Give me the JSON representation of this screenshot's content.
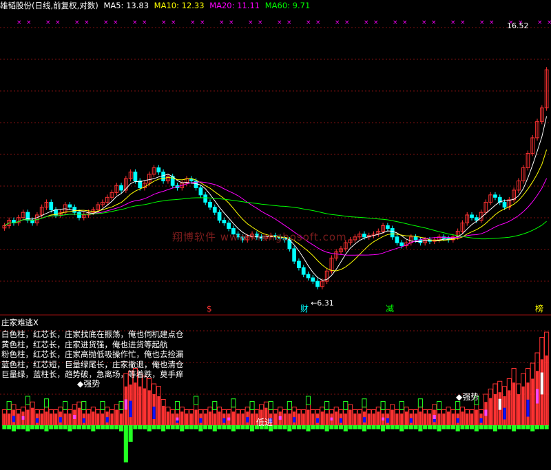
{
  "header": {
    "title": "雄韬股份(日线,前复权,对数)",
    "ma5_label": "MA5: 13.83",
    "ma10_label": "MA10: 12.33",
    "ma20_label": "MA20: 11.11",
    "ma60_label": "MA60: 9.71"
  },
  "colors": {
    "up": "#ff3232",
    "down": "#00ffff",
    "ma5": "#ffffff",
    "ma10": "#ffff00",
    "ma20": "#ff00ff",
    "ma60": "#00ff00",
    "grid": "#801010",
    "marker": "#ff00ff",
    "green_bar": "#22ff22",
    "blue_bar": "#1010ff",
    "pink_bar": "#ff44ff",
    "white_bar": "#ffffff"
  },
  "price_chart": {
    "high_label": "16.52",
    "low_label": "6.31",
    "signal_labels": [
      "$",
      "财",
      "减",
      "榜"
    ],
    "watermark": "翔博软件 www.xiangbosoft.com"
  },
  "indicator": {
    "title": "庄家难逃X",
    "legend_lines": [
      "白色柱，红芯长，庄家找底在振荡，俺也伺机建点仓",
      "黄色柱，红芯长，庄家进货强，俺也进货等起航",
      "粉色柱，红芯长，庄家高抛低吸操作忙，俺也去捡漏",
      "蓝色柱，红芯短，巨量绿尾长，庄家撤退，俺也清仓",
      "巨量绿，蓝柱长，趋势破，急离场，等着跌，莫手痒"
    ],
    "annotations": [
      "◆强势",
      "◆强势",
      "低进"
    ]
  },
  "chart_data": {
    "type": "candlestick",
    "title": "雄韬股份(日线,前复权,对数)",
    "yscale": "log",
    "ylim": [
      6.0,
      17.5
    ],
    "annotated_high": 16.52,
    "annotated_low": 6.31,
    "series_ma": [
      {
        "name": "MA5",
        "last": 13.83
      },
      {
        "name": "MA10",
        "last": 12.33
      },
      {
        "name": "MA20",
        "last": 11.11
      },
      {
        "name": "MA60",
        "last": 9.71
      }
    ],
    "closes": [
      8.4,
      8.6,
      8.5,
      8.7,
      8.9,
      8.6,
      8.5,
      8.8,
      9.1,
      9.3,
      9.0,
      8.8,
      8.9,
      9.2,
      9.1,
      8.9,
      8.7,
      8.8,
      8.9,
      9.0,
      9.2,
      9.3,
      9.5,
      9.7,
      10.0,
      9.8,
      10.3,
      10.6,
      10.2,
      9.9,
      10.1,
      10.5,
      10.8,
      10.6,
      10.2,
      10.4,
      10.0,
      9.9,
      10.1,
      10.3,
      10.2,
      9.9,
      9.6,
      9.3,
      9.1,
      8.9,
      8.6,
      8.5,
      8.3,
      8.1,
      8.0,
      7.9,
      8.0,
      8.1,
      8.0,
      7.95,
      8.0,
      8.05,
      8.0,
      7.95,
      7.9,
      7.6,
      7.2,
      7.0,
      6.8,
      6.7,
      6.6,
      6.45,
      6.6,
      6.9,
      7.3,
      7.5,
      7.6,
      7.8,
      7.9,
      8.0,
      8.1,
      8.0,
      8.05,
      8.1,
      8.2,
      8.4,
      8.3,
      8.0,
      7.8,
      7.7,
      7.8,
      8.0,
      7.9,
      7.8,
      7.9,
      7.85,
      7.9,
      8.0,
      7.95,
      7.9,
      8.0,
      8.2,
      8.5,
      8.8,
      8.7,
      8.6,
      8.9,
      9.3,
      9.6,
      9.5,
      9.3,
      9.1,
      9.4,
      9.8,
      10.2,
      10.8,
      11.5,
      12.3,
      13.2,
      14.0,
      16.52
    ],
    "indicator_bars": [
      0.3,
      0.3,
      0.4,
      0.3,
      0.35,
      0.4,
      0.45,
      0.3,
      0.3,
      0.35,
      0.3,
      0.3,
      0.35,
      0.3,
      0.3,
      0.4,
      0.45,
      0.3,
      0.3,
      0.35,
      0.3,
      0.3,
      0.35,
      0.3,
      0.4,
      0.3,
      1.0,
      1.05,
      1.1,
      1.0,
      0.95,
      0.9,
      0.8,
      0.75,
      0.5,
      0.35,
      0.3,
      0.3,
      0.35,
      0.3,
      0.3,
      0.4,
      0.3,
      0.3,
      0.35,
      0.3,
      0.35,
      0.3,
      0.3,
      0.35,
      0.3,
      0.3,
      0.35,
      0.3,
      0.3,
      0.4,
      0.45,
      0.3,
      0.3,
      0.35,
      0.3,
      0.3,
      0.35,
      0.3,
      0.3,
      0.4,
      0.3,
      0.3,
      0.35,
      0.3,
      0.3,
      0.35,
      0.3,
      0.3,
      0.4,
      0.3,
      0.3,
      0.35,
      0.3,
      0.3,
      0.35,
      0.3,
      0.3,
      0.4,
      0.3,
      0.3,
      0.35,
      0.3,
      0.3,
      0.35,
      0.3,
      0.3,
      0.4,
      0.3,
      0.3,
      0.35,
      0.3,
      0.3,
      0.35,
      0.3,
      0.3,
      0.4,
      0.3,
      0.6,
      0.7,
      0.8,
      0.85,
      0.75,
      0.9,
      1.1,
      0.8,
      1.0,
      1.1,
      1.2,
      1.4,
      1.7,
      1.8
    ],
    "indicator_neg": [
      0.1,
      0.1,
      0.15,
      0.1,
      0.1,
      0.15,
      0.1,
      0.1,
      0.1,
      0.15,
      0.1,
      0.1,
      0.1,
      0.1,
      0.15,
      0.1,
      0.1,
      0.1,
      0.1,
      0.15,
      0.1,
      0.1,
      0.1,
      0.1,
      0.1,
      0.15,
      0.9,
      0.4,
      0.1,
      0.1,
      0.1,
      0.15,
      0.1,
      0.1,
      0.15,
      0.1,
      0.1,
      0.1,
      0.15,
      0.1,
      0.1,
      0.1,
      0.15,
      0.1,
      0.1,
      0.15,
      0.1,
      0.1,
      0.1,
      0.15,
      0.1,
      0.1,
      0.1,
      0.15,
      0.1,
      0.1,
      0.1,
      0.15,
      0.1,
      0.1,
      0.1,
      0.15,
      0.1,
      0.1,
      0.1,
      0.15,
      0.1,
      0.1,
      0.1,
      0.15,
      0.1,
      0.1,
      0.1,
      0.15,
      0.1,
      0.1,
      0.1,
      0.15,
      0.1,
      0.1,
      0.1,
      0.15,
      0.1,
      0.1,
      0.1,
      0.15,
      0.1,
      0.1,
      0.1,
      0.15,
      0.1,
      0.1,
      0.1,
      0.15,
      0.1,
      0.1,
      0.1,
      0.15,
      0.1,
      0.1,
      0.1,
      0.15,
      0.1,
      0.1,
      0.1,
      0.15,
      0.1,
      0.1,
      0.1,
      0.15,
      0.1,
      0.1,
      0.1,
      0.15,
      0.1,
      0.1,
      0.1
    ]
  }
}
